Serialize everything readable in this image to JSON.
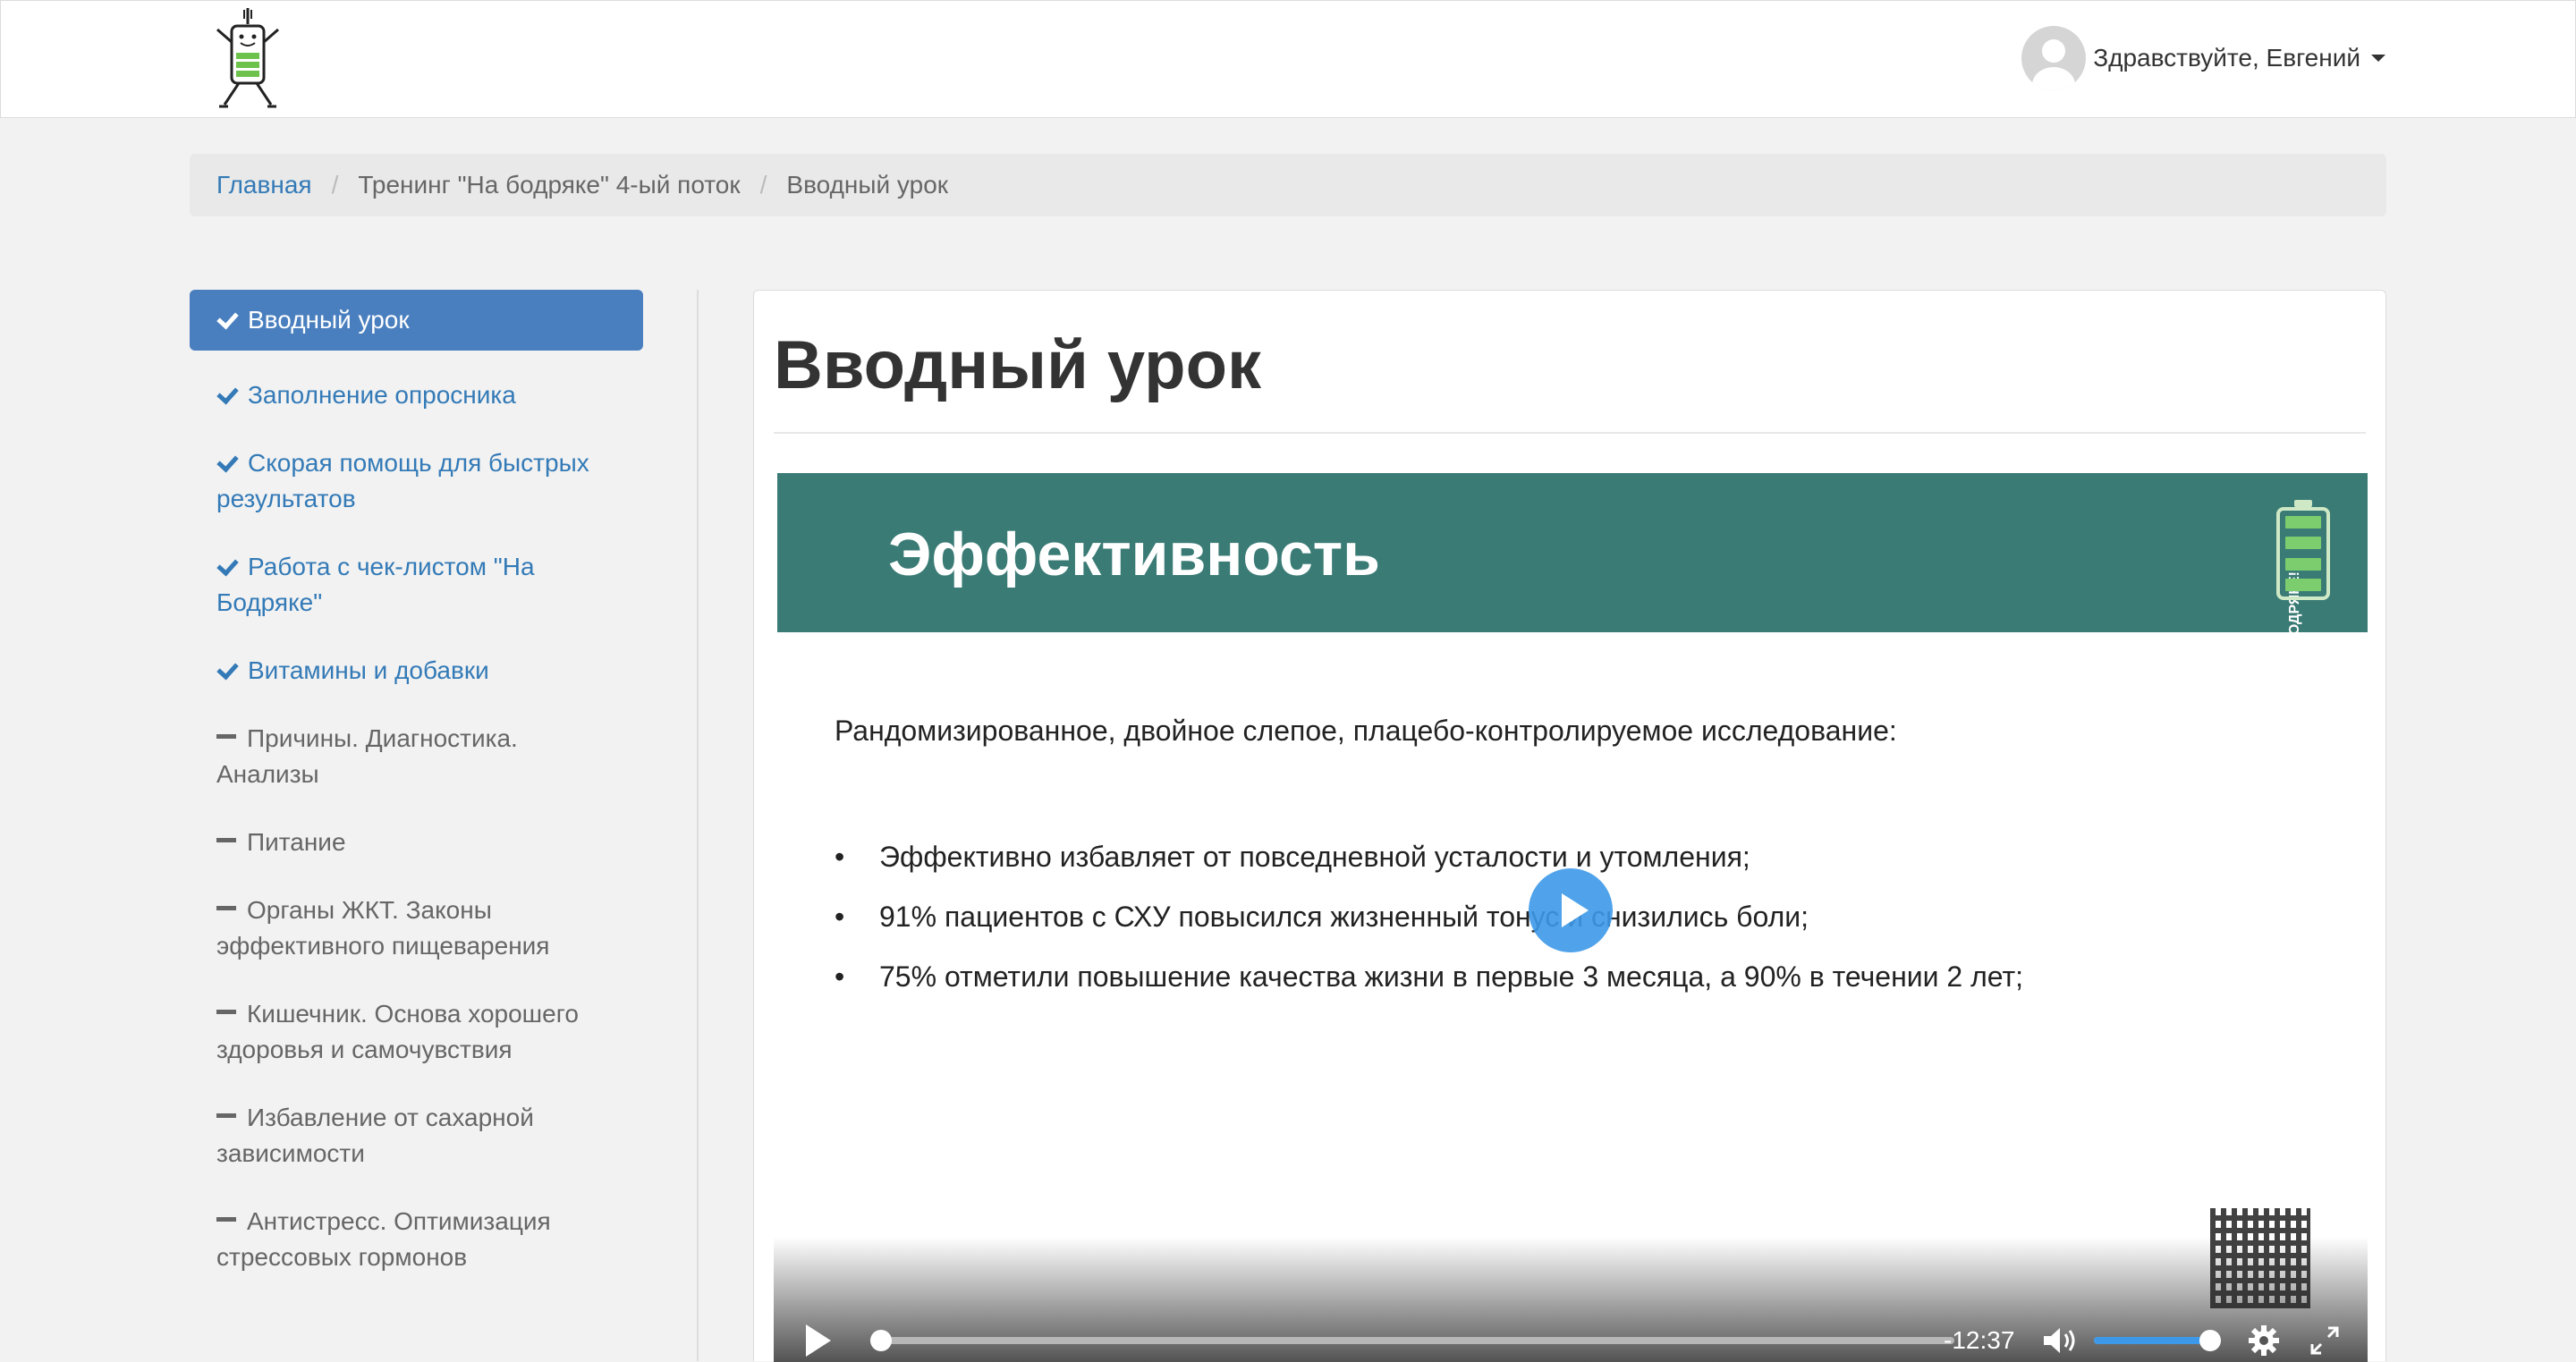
{
  "header": {
    "greeting": "Здравствуйте, Евгений"
  },
  "breadcrumb": {
    "home": "Главная",
    "course": "Тренинг \"На бодряке\" 4-ый поток",
    "current": "Вводный урок"
  },
  "sidebar": {
    "items": [
      {
        "label": "Вводный урок",
        "status": "done",
        "active": true
      },
      {
        "label": "Заполнение опросника",
        "status": "done"
      },
      {
        "label": "Скорая помощь для быстрых результатов",
        "status": "done"
      },
      {
        "label": "Работа с чек-листом \"На Бодряке\"",
        "status": "done"
      },
      {
        "label": "Витамины и добавки",
        "status": "done"
      },
      {
        "label": "Причины. Диагностика. Анализы",
        "status": "pending"
      },
      {
        "label": "Питание",
        "status": "pending"
      },
      {
        "label": "Органы ЖКТ. Законы эффективного пищеварения",
        "status": "pending"
      },
      {
        "label": "Кишечник. Основа хорошего здоровья и самочувствия",
        "status": "pending"
      },
      {
        "label": "Избавление от сахарной зависимости",
        "status": "pending"
      },
      {
        "label": "Антистресс. Оптимизация стрессовых гормонов",
        "status": "pending"
      }
    ]
  },
  "main": {
    "title": "Вводный урок"
  },
  "video": {
    "slide_title": "Эффективность",
    "slide_brand": "НА БОДРЯКЕ!",
    "slide_intro": "Рандомизированное, двойное слепое, плацебо-контролируемое исследование:",
    "slide_points": [
      "Эффективно избавляет от повседневной усталости и утомления;",
      "91% пациентов с СХУ повысился жизненный тонус и снизились боли;",
      "75% отметили повышение качества жизни в первые 3 месяца, а 90% в течении 2 лет;"
    ],
    "time_remaining": "-12:37",
    "progress": 0,
    "volume": 1.0
  },
  "colors": {
    "link": "#337ab7",
    "active_item": "#4a7fbf",
    "slide_header": "#3a7b75",
    "player_accent": "#3d99e8"
  }
}
